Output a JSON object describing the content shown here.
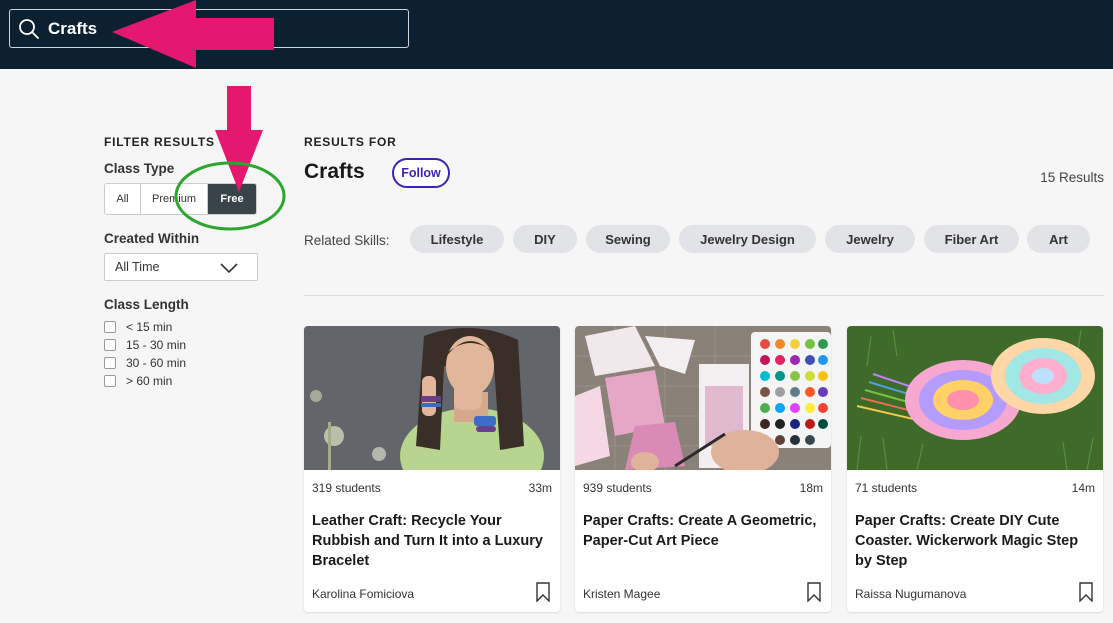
{
  "search": {
    "value": "Crafts"
  },
  "filters": {
    "heading": "FILTER RESULTS",
    "class_type": {
      "label": "Class Type",
      "options": [
        "All",
        "Premium",
        "Free"
      ],
      "selected": "Free"
    },
    "created_within": {
      "label": "Created Within",
      "selected": "All Time"
    },
    "class_length": {
      "label": "Class Length",
      "options": [
        "< 15 min",
        "15 - 30 min",
        "30 - 60 min",
        "> 60 min"
      ]
    }
  },
  "results": {
    "label": "RESULTS FOR",
    "title": "Crafts",
    "follow_label": "Follow",
    "count": "15 Results",
    "related_label": "Related Skills:",
    "skills": [
      "Lifestyle",
      "DIY",
      "Sewing",
      "Jewelry Design",
      "Jewelry",
      "Fiber Art",
      "Art"
    ]
  },
  "cards": [
    {
      "students": "319 students",
      "duration": "33m",
      "title": "Leather Craft: Recycle Your Rubbish and Turn It into a Luxury Bracelet",
      "author": "Karolina Fomiciova"
    },
    {
      "students": "939 students",
      "duration": "18m",
      "title": "Paper Crafts: Create A Geometric, Paper-Cut Art Piece",
      "author": "Kristen Magee"
    },
    {
      "students": "71 students",
      "duration": "14m",
      "title": "Paper Crafts: Create DIY Cute Coaster. Wickerwork Magic Step by Step",
      "author": "Raissa Nugumanova"
    }
  ],
  "colors": {
    "topbar": "#0b2132",
    "accent": "#3b24b5",
    "annotation_arrow": "#e4186e",
    "annotation_circle": "#2ea52e"
  }
}
